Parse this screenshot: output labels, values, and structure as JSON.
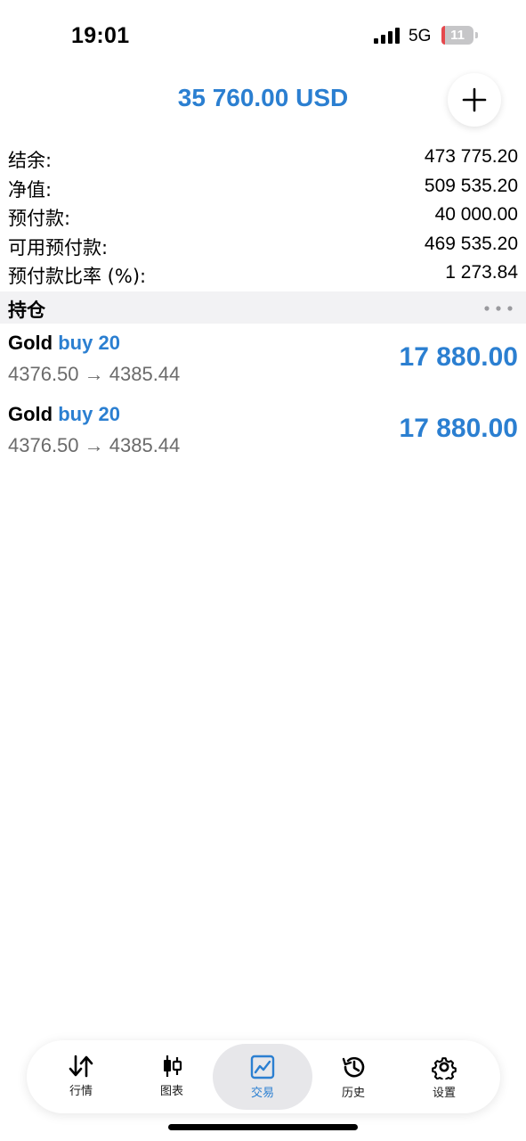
{
  "status": {
    "time": "19:01",
    "network": "5G",
    "battery_level": "11",
    "battery_fraction": 0.11
  },
  "header": {
    "total": "35 760.00 USD",
    "add_icon": "plus-icon"
  },
  "account": [
    {
      "label": "结余:",
      "value": "473 775.20"
    },
    {
      "label": "净值:",
      "value": "509 535.20"
    },
    {
      "label": "预付款:",
      "value": "40 000.00"
    },
    {
      "label": "可用预付款:",
      "value": "469 535.20"
    },
    {
      "label": "预付款比率 (%):",
      "value": "1 273.84"
    }
  ],
  "positions_section": {
    "title": "持仓",
    "more_icon": "more-dots-icon"
  },
  "positions": [
    {
      "symbol": "Gold",
      "side": "buy 20",
      "prices": "4376.50 → 4385.44",
      "profit": "17 880.00"
    },
    {
      "symbol": "Gold",
      "side": "buy 20",
      "prices": "4376.50 → 4385.44",
      "profit": "17 880.00"
    }
  ],
  "tabs": [
    {
      "label": "行情",
      "icon": "quotes-arrows-icon",
      "active": false
    },
    {
      "label": "图表",
      "icon": "candlestick-chart-icon",
      "active": false
    },
    {
      "label": "交易",
      "icon": "trade-chart-icon",
      "active": true
    },
    {
      "label": "历史",
      "icon": "history-clock-icon",
      "active": false
    },
    {
      "label": "设置",
      "icon": "settings-gear-icon",
      "active": false
    }
  ],
  "colors": {
    "accent": "#2b7fd1",
    "section_bg": "#f2f2f4",
    "muted_text": "#6b6b6b"
  }
}
